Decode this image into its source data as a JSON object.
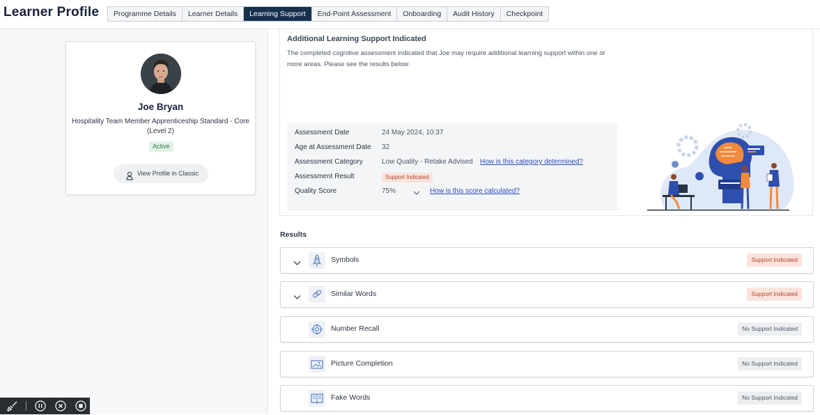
{
  "header": {
    "title": "Learner Profile",
    "tabs": [
      {
        "label": "Programme Details",
        "active": false
      },
      {
        "label": "Learner Details",
        "active": false
      },
      {
        "label": "Learning Support",
        "active": true
      },
      {
        "label": "End-Point Assessment",
        "active": false
      },
      {
        "label": "Onboarding",
        "active": false
      },
      {
        "label": "Audit History",
        "active": false
      },
      {
        "label": "Checkpoint",
        "active": false
      }
    ]
  },
  "profile": {
    "name": "Joe Bryan",
    "programme": "Hospitality Team Member Apprenticeship Standard - Core (Level 2)",
    "status": "Active",
    "classic_button": "View Profile in Classic"
  },
  "summary": {
    "title": "Additional Learning Support Indicated",
    "text": "The completed cognitive assessment indicated that Joe may require additional learning support within one or more areas. Please see the results below.",
    "details": [
      {
        "label": "Assessment Date",
        "value": "24 May 2024, 10:37"
      },
      {
        "label": "Age at Assessment Date",
        "value": "32"
      },
      {
        "label": "Assessment Category",
        "value": "Low Quality - Retake Advised",
        "link": "How is this category determined?"
      },
      {
        "label": "Assessment Result",
        "badge": "Support Indicated"
      },
      {
        "label": "Quality Score",
        "value": "75%",
        "link": "How is this score calculated?"
      }
    ]
  },
  "results": {
    "title": "Results",
    "items": [
      {
        "label": "Symbols",
        "badge": "Support Indicated",
        "support": true,
        "expandable": true,
        "icon": "rocket-icon"
      },
      {
        "label": "Similar Words",
        "badge": "Support Indicated",
        "support": true,
        "expandable": true,
        "icon": "link-icon"
      },
      {
        "label": "Number Recall",
        "badge": "No Support Indicated",
        "support": false,
        "expandable": false,
        "icon": "target-icon"
      },
      {
        "label": "Picture Completion",
        "badge": "No Support Indicated",
        "support": false,
        "expandable": false,
        "icon": "picture-icon"
      },
      {
        "label": "Fake Words",
        "badge": "No Support Indicated",
        "support": false,
        "expandable": false,
        "icon": "book-icon"
      }
    ]
  },
  "colors": {
    "active_tab": "#16304d",
    "support_badge_text": "#b2432a",
    "support_badge_bg": "#fbe3dc",
    "link": "#2b4bb8"
  }
}
